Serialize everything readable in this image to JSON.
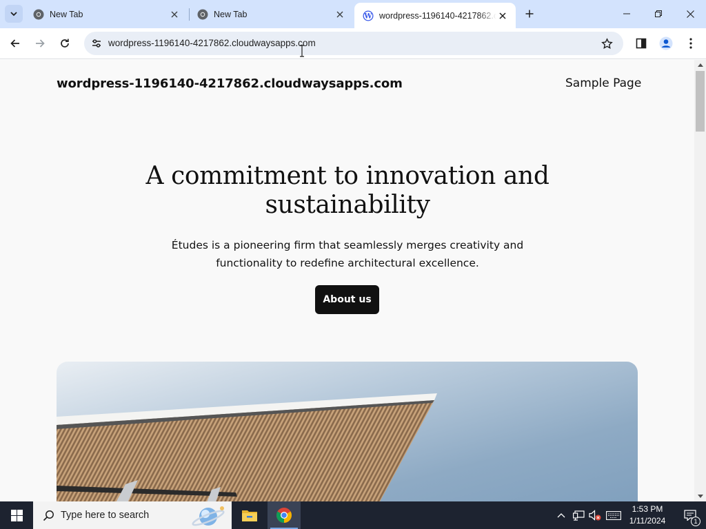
{
  "browser": {
    "tabs": [
      {
        "title": "New Tab",
        "active": false,
        "favicon": "chrome-icon"
      },
      {
        "title": "New Tab",
        "active": false,
        "favicon": "chrome-icon"
      },
      {
        "title": "wordpress-1196140-4217862.cl",
        "active": true,
        "favicon": "wordpress-icon"
      }
    ],
    "address_bar": {
      "url": "wordpress-1196140-4217862.cloudwaysapps.com"
    },
    "colors": {
      "tabstrip": "#d3e3fd",
      "omnibox": "#e9eef6"
    }
  },
  "page": {
    "site_title": "wordpress-1196140-4217862.cloudwaysapps.com",
    "nav": {
      "link": "Sample Page"
    },
    "hero": {
      "heading": "A commitment to innovation and sustainability",
      "text": "Études is a pioneering firm that seamlessly merges creativity and functionality to redefine architectural excellence.",
      "button": "About us"
    },
    "colors": {
      "background": "#f9f9f9",
      "text": "#111111",
      "button_bg": "#111111"
    }
  },
  "taskbar": {
    "search_placeholder": "Type here to search",
    "apps": [
      "file-explorer-icon",
      "chrome-icon"
    ],
    "clock": {
      "time": "1:53 PM",
      "date": "1/11/2024"
    },
    "notification_count": "1"
  }
}
